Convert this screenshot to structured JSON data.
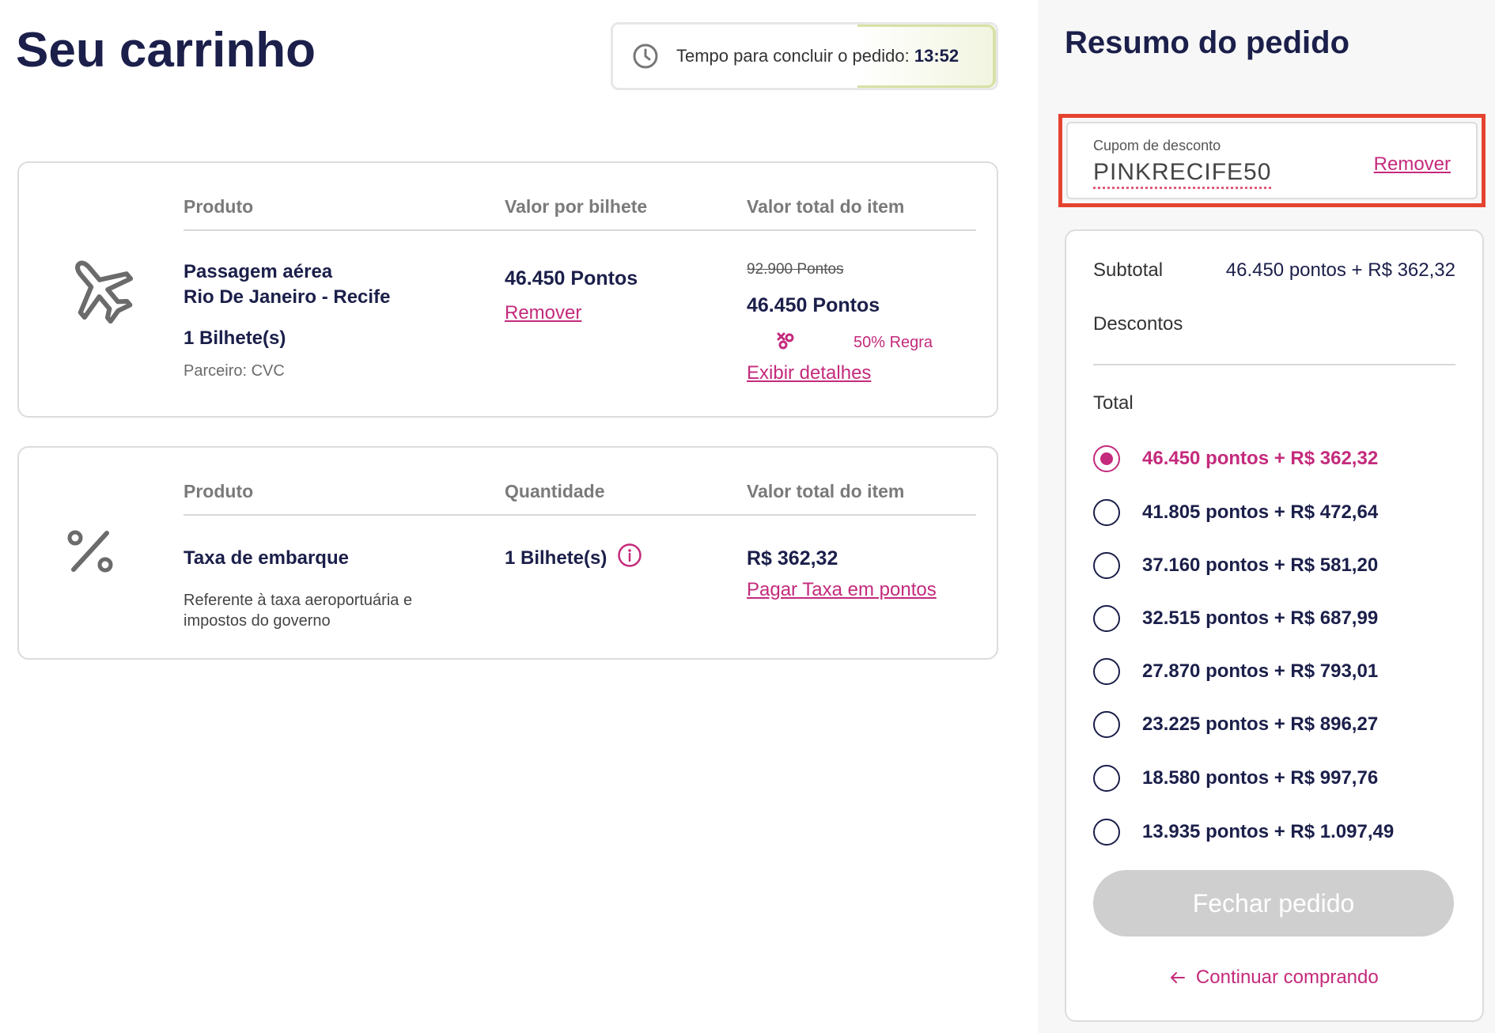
{
  "page": {
    "title": "Seu carrinho"
  },
  "timer": {
    "label": "Tempo para concluir o pedido:",
    "time": "13:52"
  },
  "cart": {
    "flight": {
      "headers": {
        "product": "Produto",
        "unit_value": "Valor por bilhete",
        "total": "Valor total do item"
      },
      "icon": "airplane-icon",
      "name_line1": "Passagem aérea",
      "name_line2": "Rio De Janeiro - Recife",
      "tickets": "1 Bilhete(s)",
      "partner": "Parceiro: CVC",
      "unit_price": "46.450 Pontos",
      "remove_label": "Remover",
      "original_total": "92.900 Pontos",
      "total": "46.450 Pontos",
      "promo_label": "50% Regra",
      "details_label": "Exibir detalhes"
    },
    "fee": {
      "headers": {
        "product": "Produto",
        "quantity": "Quantidade",
        "total": "Valor total do item"
      },
      "icon": "percent-icon",
      "name": "Taxa de embarque",
      "desc_line1": "Referente à taxa aeroportuária e",
      "desc_line2": "impostos do governo",
      "quantity": "1 Bilhete(s)",
      "total": "R$ 362,32",
      "pay_points_label": "Pagar Taxa em pontos"
    }
  },
  "summary": {
    "title": "Resumo do pedido",
    "coupon": {
      "label": "Cupom de desconto",
      "code": "PINKRECIFE50",
      "remove_label": "Remover"
    },
    "subtotal_label": "Subtotal",
    "subtotal_value": "46.450 pontos + R$ 362,32",
    "discounts_label": "Descontos",
    "total_label": "Total",
    "options": [
      {
        "label": "46.450 pontos + R$ 362,32",
        "selected": true
      },
      {
        "label": "41.805 pontos + R$ 472,64",
        "selected": false
      },
      {
        "label": "37.160 pontos + R$ 581,20",
        "selected": false
      },
      {
        "label": "32.515 pontos + R$ 687,99",
        "selected": false
      },
      {
        "label": "27.870 pontos + R$ 793,01",
        "selected": false
      },
      {
        "label": "23.225 pontos + R$ 896,27",
        "selected": false
      },
      {
        "label": "18.580 pontos + R$ 997,76",
        "selected": false
      },
      {
        "label": "13.935 pontos + R$ 1.097,49",
        "selected": false
      }
    ],
    "checkout_label": "Fechar pedido",
    "continue_label": "Continuar comprando"
  },
  "colors": {
    "navy": "#1b1f4a",
    "pink": "#c42a7c",
    "highlight": "#e5432f",
    "disabled": "#cfcfcf"
  }
}
